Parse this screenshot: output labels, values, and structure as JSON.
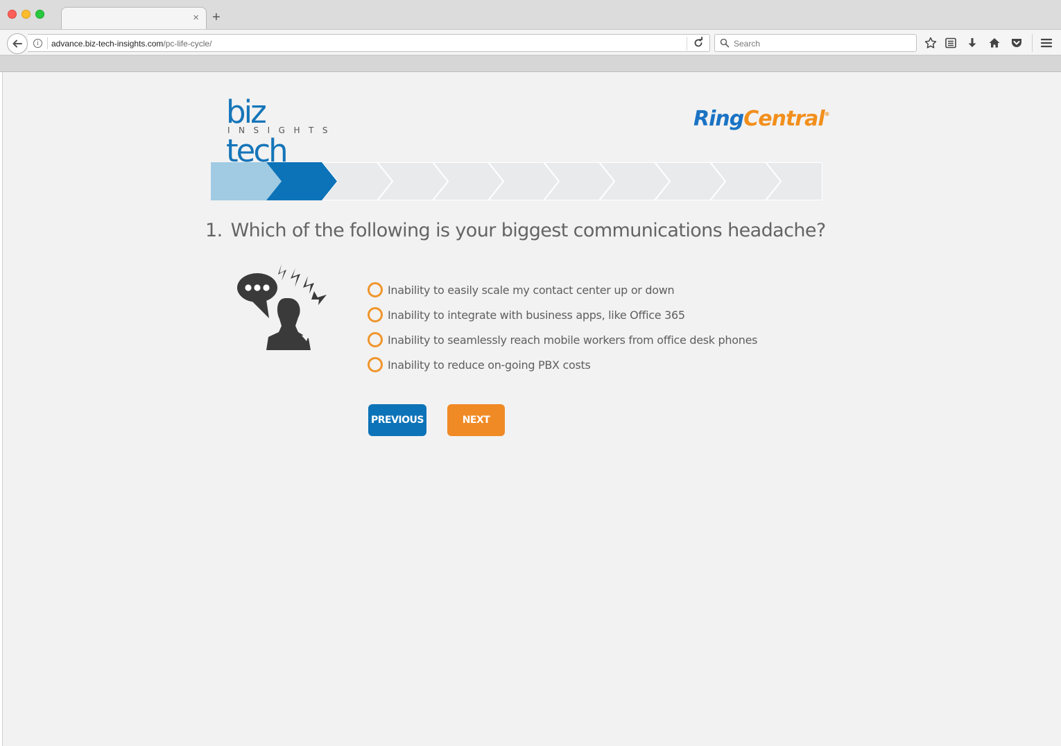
{
  "browser": {
    "tab_title": "",
    "url_host": "advance.biz-tech-insights.com",
    "url_path": "/pc-life-cycle/",
    "search_placeholder": "Search",
    "new_tab_label": "+",
    "close_tab_label": "×",
    "info_label": "i"
  },
  "logos": {
    "biz_word": "biz tech",
    "biz_sub": "INSIGHTS",
    "ring_part": "Ring",
    "central_part": "Central",
    "ring_reg": "®"
  },
  "progress": {
    "total_steps": 11,
    "current_step": 2
  },
  "question": {
    "number": "1.",
    "text": "Which of the following is your biggest communications headache?"
  },
  "options": [
    "Inability to easily scale my contact center up or down",
    "Inability to integrate with business apps, like Office 365",
    "Inability to seamlessly reach mobile workers from office desk phones",
    "Inability to reduce on-going PBX costs"
  ],
  "buttons": {
    "previous": "PREVIOUS",
    "next": "NEXT"
  },
  "colors": {
    "brand_blue": "#0c73b8",
    "progress_done": "#a0cbe3",
    "progress_current": "#0c73b8",
    "progress_pending": "#e8eaec",
    "accent_orange": "#f08a25",
    "page_bg": "#f2f2f2"
  },
  "icons": {
    "illustration": "frustrated-person-with-speech-bubble-icon"
  }
}
